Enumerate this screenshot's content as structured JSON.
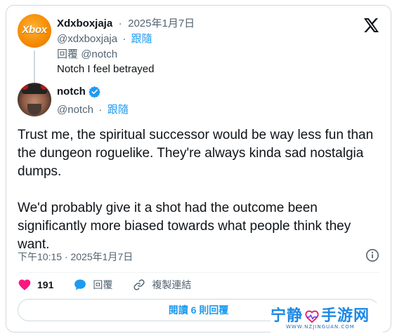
{
  "reply_to_tweet": {
    "avatar_text": "Xbox",
    "display_name": "Xdxboxjaja",
    "separator": "·",
    "date": "2025年1月7日",
    "handle": "@xdxboxjaja",
    "follow_label": "跟隨",
    "reply_label": "回覆",
    "reply_to_handle": "@notch",
    "text": "Notch I feel betrayed"
  },
  "main_tweet": {
    "display_name": "notch",
    "handle": "@notch",
    "follow_label": "跟隨",
    "paragraphs": [
      "Trust me, the spiritual successor would be way less fun than the dungeon roguelike. They're always kinda sad nostalgia dumps.",
      "We'd probably give it a shot had the outcome been significantly more biased towards what people think they want."
    ],
    "timestamp": "下午10:15 · 2025年1月7日"
  },
  "actions": {
    "like_count": "191",
    "reply_label": "回覆",
    "copy_link_label": "複製連結"
  },
  "read_replies_label": "閱讀 6 則回覆",
  "watermark": {
    "main_left": "宁静",
    "main_right": "手游网",
    "sub": "WWW.NZJINGUAN.COM"
  },
  "colors": {
    "accent": "#1d9bf0",
    "like": "#f91880",
    "muted": "#536471",
    "text": "#0f1419",
    "border": "#cfd9de"
  },
  "icons": {
    "brand": "x-logo-icon",
    "verified": "verified-badge-icon",
    "info": "info-icon",
    "like": "heart-icon",
    "reply": "chat-bubble-icon",
    "copy_link": "link-icon"
  }
}
